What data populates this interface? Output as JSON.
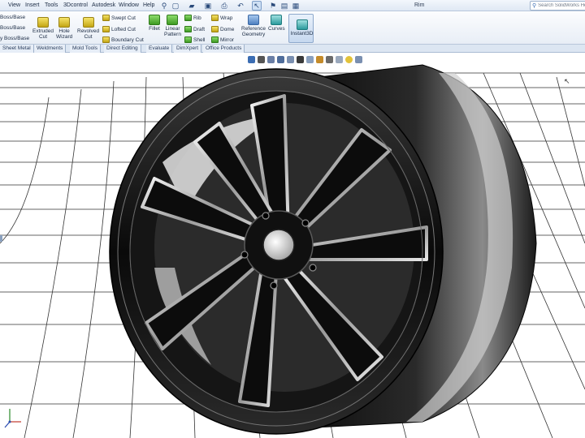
{
  "menu": {
    "items": [
      "View",
      "Insert",
      "Tools",
      "3Dcontrol",
      "Autodesk",
      "Window",
      "Help"
    ],
    "doc_title": "Rim",
    "search_placeholder": "Search SolidWorks Help"
  },
  "ribbon": {
    "left_items": [
      "Boss/Base",
      "Boss/Base",
      "y Boss/Base"
    ],
    "extruded_cut": "Extruded\nCut",
    "hole_wizard": "Hole\nWizard",
    "revolved_cut": "Revolved\nCut",
    "swept_cut": "Swept Cut",
    "lofted_cut": "Lofted Cut",
    "boundary_cut": "Boundary Cut",
    "fillet": "Fillet",
    "linear_pattern": "Linear\nPattern",
    "rib": "Rib",
    "draft": "Draft",
    "shell": "Shell",
    "wrap": "Wrap",
    "dome": "Dome",
    "mirror": "Mirror",
    "reference_geometry": "Reference\nGeometry",
    "curves": "Curves",
    "instant3d": "Instant3D"
  },
  "tabs": [
    "Sheet Metal",
    "Weldments",
    "Mold Tools",
    "Direct Editing",
    "Evaluate",
    "DimXpert",
    "Office Products"
  ],
  "colors": {
    "accent": "#3b6db3",
    "ribbon_bg": "#eef3f9",
    "tab_bg": "#dce6f2",
    "tire_dark": "#111111",
    "spoke_chrome": "#d8d8d8"
  },
  "icons": {
    "search": "search-icon",
    "instant3d": "instant3d-icon",
    "triad": "axis-triad-icon"
  }
}
